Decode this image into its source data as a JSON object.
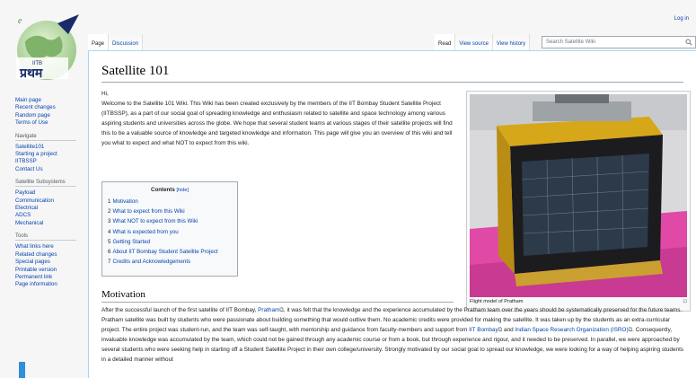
{
  "logo": {
    "text": "प्रथम",
    "subtext": "IITB"
  },
  "sidebar": {
    "main_items": [
      {
        "label": "Main page"
      },
      {
        "label": "Recent changes"
      },
      {
        "label": "Random page"
      },
      {
        "label": "Terms of Use"
      }
    ],
    "navigate": {
      "heading": "Navigate",
      "items": [
        {
          "label": "Satellite101"
        },
        {
          "label": "Starting a project"
        },
        {
          "label": "IITBSSP"
        },
        {
          "label": "Contact Us"
        }
      ]
    },
    "subsystems": {
      "heading": "Satellite Subsystems",
      "items": [
        {
          "label": "Payload"
        },
        {
          "label": "Communication"
        },
        {
          "label": "Electrical"
        },
        {
          "label": "ADCS"
        },
        {
          "label": "Mechanical"
        }
      ]
    },
    "tools": {
      "heading": "Tools",
      "items": [
        {
          "label": "What links here"
        },
        {
          "label": "Related changes"
        },
        {
          "label": "Special pages"
        },
        {
          "label": "Printable version"
        },
        {
          "label": "Permanent link"
        },
        {
          "label": "Page information"
        }
      ]
    }
  },
  "personal": {
    "login": "Log in"
  },
  "tabs": {
    "page": "Page",
    "discussion": "Discussion",
    "read": "Read",
    "view_source": "View source",
    "view_history": "View history"
  },
  "search": {
    "placeholder": "Search Satellite Wiki"
  },
  "article": {
    "title": "Satellite 101",
    "greeting": "Hi,",
    "intro": "Welcome to the Satellite 101 Wiki. This Wiki has been created exclusively by the members of the IIT Bombay Student Satellite Project (IITBSSP), as a part of our social goal of spreading knowledge and enthusiasm related to satellite and space technology among various aspiring students and universities across the globe. We hope that several student teams at various stages of their satellite projects will find this to be a valuable source of knowledge and targeted knowledge and information. This page will give you an overview of this wiki and tell you what to expect and what NOT to expect from this wiki.",
    "thumb_caption": "Flight model of Pratham",
    "toc": {
      "title": "Contents",
      "hide": "[hide]",
      "items": [
        {
          "num": "1",
          "label": "Motivation"
        },
        {
          "num": "2",
          "label": "What to expect from this Wiki"
        },
        {
          "num": "3",
          "label": "What NOT to expect from this Wiki"
        },
        {
          "num": "4",
          "label": "What is expected from you"
        },
        {
          "num": "5",
          "label": "Getting Started"
        },
        {
          "num": "6",
          "label": "About IIT Bombay Student Satellite Project"
        },
        {
          "num": "7",
          "label": "Credits and Acknowledgements"
        }
      ]
    },
    "section": {
      "heading": "Motivation",
      "p1": "After the successful launch of the first satellite of IIT Bombay,",
      "pratham": "Pratham",
      "p2": ", it was felt that the knowledge and the experience accumulated by the Pratham team over the years should be systematically preserved for the future teams. Pratham satellite was built by students who were passionate about building something that would outlive them. No academic credits were provided for making the satellite. It was taken up by the students as an extra-curricular project. The entire project was student-run, and the team was self-taught, with mentorship and guidance from faculty-members and support from",
      "iitb": "IIT Bombay",
      "and": "and",
      "isro": "Indian Space Research Organization (ISRO)",
      "p3": ". Consequently, invaluable knowledge was accumulated by the team, which could not be gained through any academic course or from a book, but through experience and rigour, and it needed to be preserved. In parallel, we were approached by several students who were seeking help in starting off a Student Satellite Project in their own college/university. Strongly motivated by our social goal to spread our knowledge, we were looking for a way of helping aspiring students in a detailed manner without"
    }
  },
  "colors": {
    "link": "#0645ad",
    "border": "#a7d7f9",
    "sidebar_accent": "#2f8fd8"
  }
}
